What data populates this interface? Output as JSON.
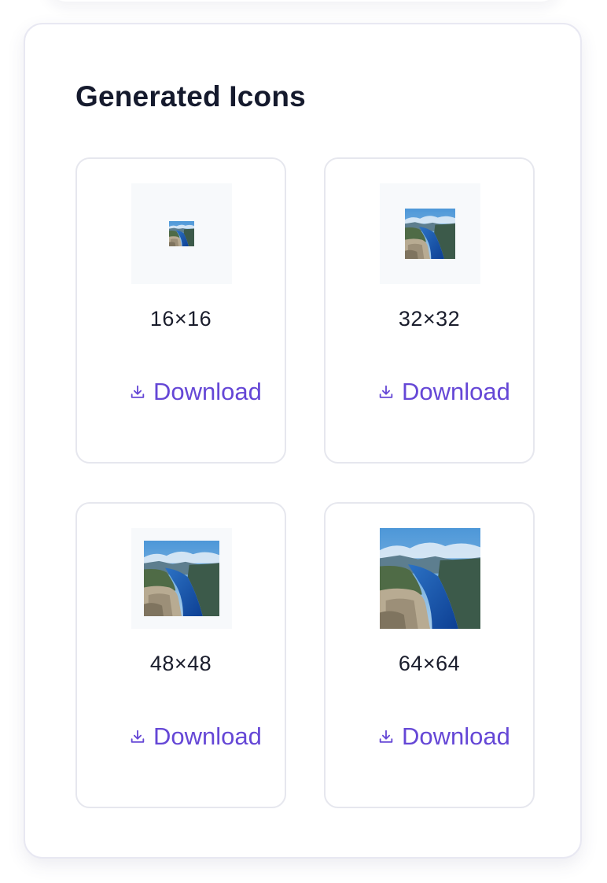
{
  "panel": {
    "title": "Generated Icons"
  },
  "icons": [
    {
      "size_label": "16×16",
      "download_label": "Download"
    },
    {
      "size_label": "32×32",
      "download_label": "Download"
    },
    {
      "size_label": "48×48",
      "download_label": "Download"
    },
    {
      "size_label": "64×64",
      "download_label": "Download"
    }
  ],
  "colors": {
    "accent": "#6547d6",
    "title": "#151a2d",
    "border": "#e6e7ee",
    "preview_bg": "#f7f9fb"
  },
  "icon_names": {
    "download": "download-icon",
    "preview": "fjord-landscape-thumbnail"
  }
}
